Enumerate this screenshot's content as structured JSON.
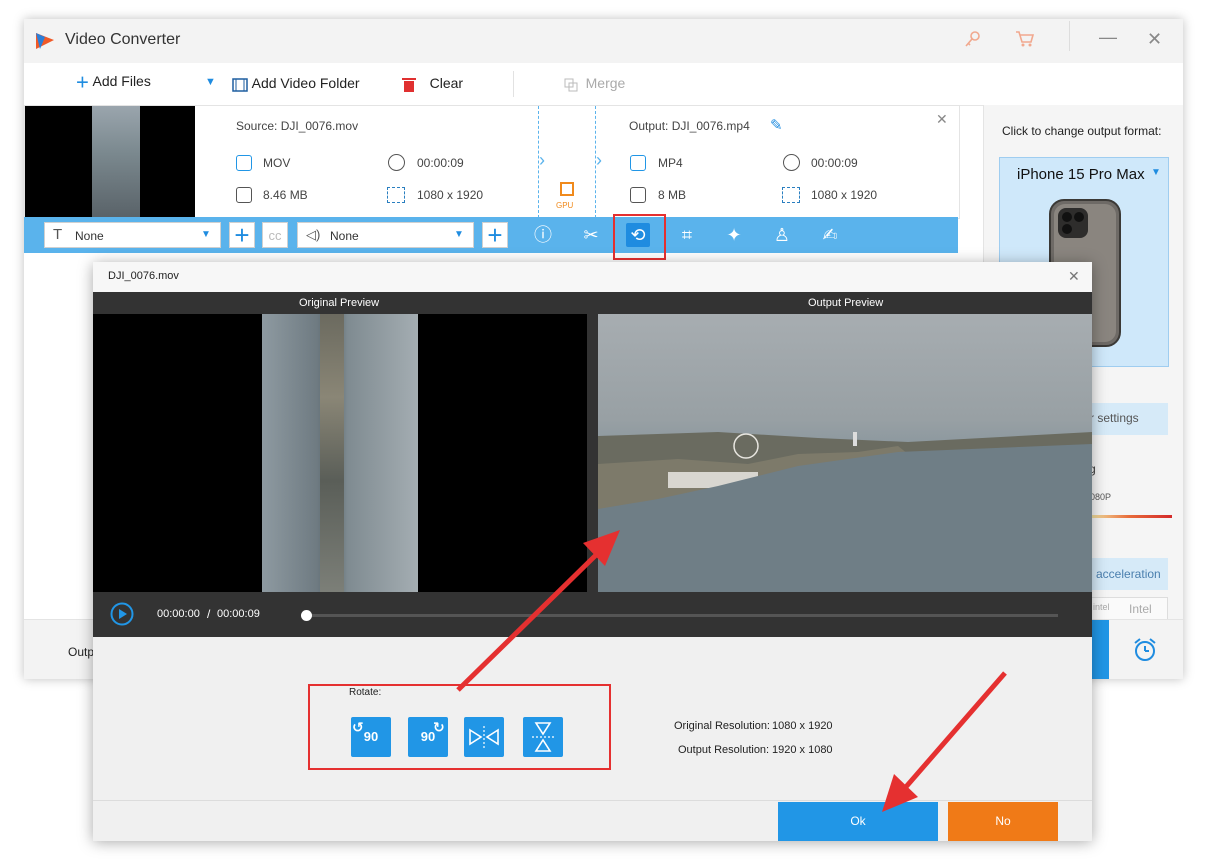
{
  "app": {
    "title": "Video Converter"
  },
  "toolbar": {
    "add_files": "Add Files",
    "add_video_folder": "Add Video Folder",
    "clear": "Clear",
    "merge": "Merge"
  },
  "file": {
    "source_label": "Source: DJI_0076.mov",
    "output_label": "Output: DJI_0076.mp4",
    "source_format": "MOV",
    "source_duration": "00:00:09",
    "source_size": "8.46 MB",
    "source_resolution": "1080 x 1920",
    "output_format": "MP4",
    "output_duration": "00:00:09",
    "output_size": "8 MB",
    "output_resolution": "1080 x 1920",
    "gpu_label": "GPU"
  },
  "editbar": {
    "subtitle_select": "None",
    "audio_select": "None"
  },
  "right_panel": {
    "change_format_hint": "Click to change output format:",
    "format_name": "iPhone 15 Pro Max",
    "settings_partial": "r settings",
    "resolution_partial": "g",
    "slider_label": "080P",
    "acceleration_partial": "acceleration",
    "intel_label": "Intel"
  },
  "bottom": {
    "output_partial": "Outp"
  },
  "dialog": {
    "title": "DJI_0076.mov",
    "original_preview": "Original Preview",
    "output_preview": "Output Preview",
    "current_time": "00:00:00",
    "time_separator": "/",
    "total_time": "00:00:09",
    "playback_progress": 0,
    "rotate_label": "Rotate:",
    "rotate_ccw_label": "90",
    "rotate_cw_label": "90",
    "original_resolution_label": "Original Resolution:",
    "original_resolution_value": "1080 x 1920",
    "output_resolution_label": "Output Resolution:",
    "output_resolution_value": "1920 x 1080",
    "ok_label": "Ok",
    "no_label": "No"
  },
  "colors": {
    "accent": "#2196e6",
    "edit_bar": "#5ab3ec",
    "no_button": "#f07a17",
    "annotation_red": "#e53030"
  }
}
